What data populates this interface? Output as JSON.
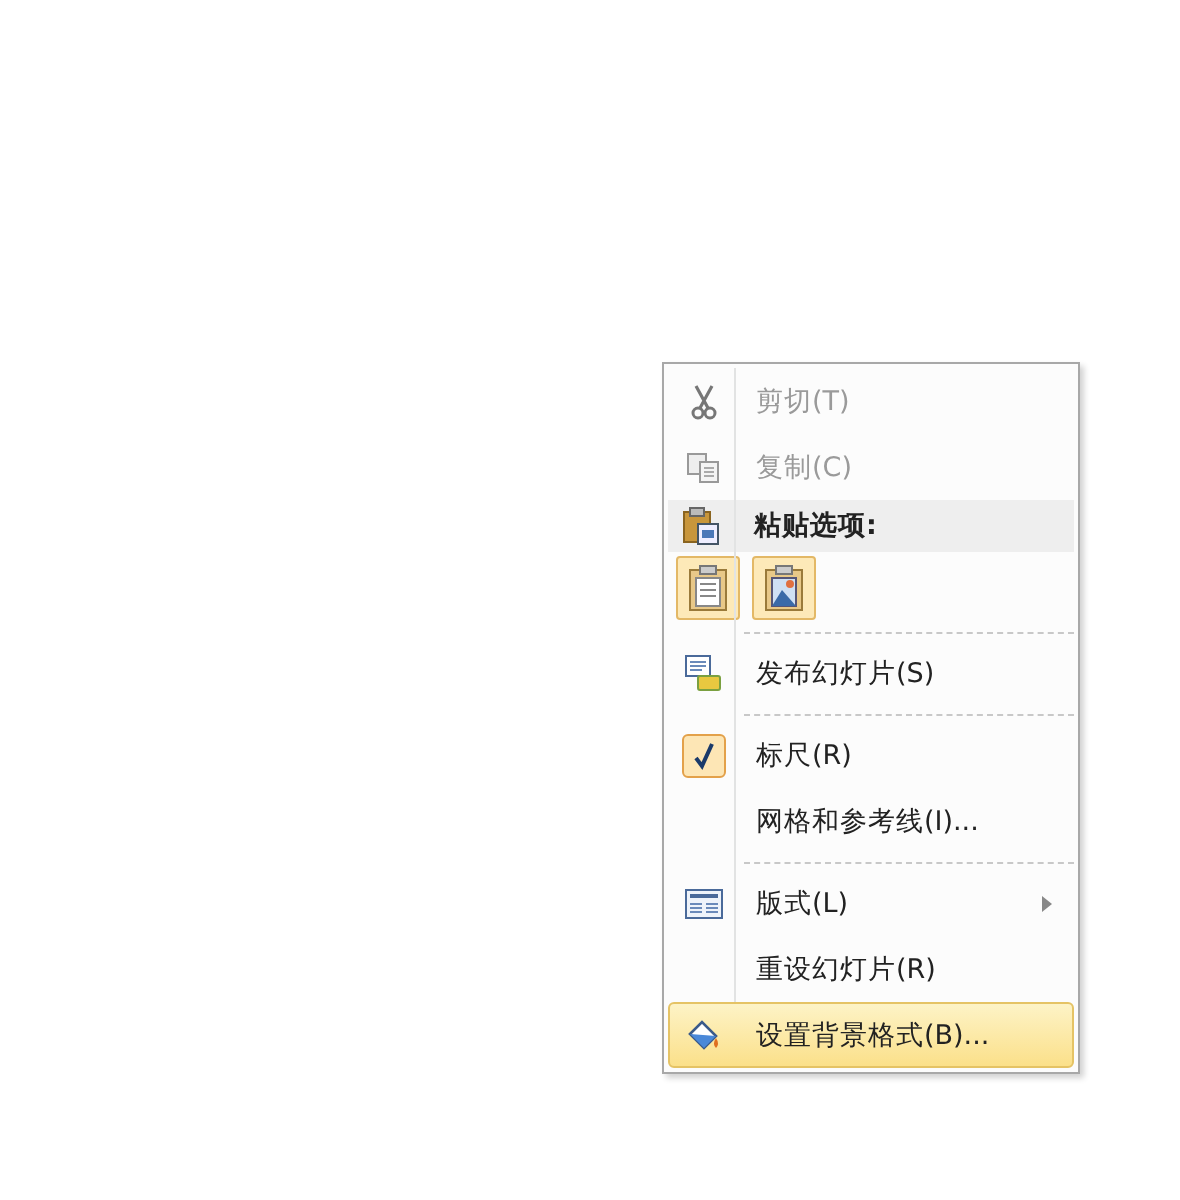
{
  "context_menu": {
    "entries": [
      {
        "kind": "item",
        "label": "剪切(T)",
        "disabled": true,
        "checked": false,
        "submenu": false,
        "selected": false
      },
      {
        "kind": "item",
        "label": "复制(C)",
        "disabled": true,
        "checked": false,
        "submenu": false,
        "selected": false
      },
      {
        "kind": "header",
        "label": "粘贴选项:"
      },
      {
        "kind": "paste_options"
      },
      {
        "kind": "separator"
      },
      {
        "kind": "item",
        "label": "发布幻灯片(S)",
        "disabled": false,
        "checked": false,
        "submenu": false,
        "selected": false
      },
      {
        "kind": "separator"
      },
      {
        "kind": "item",
        "label": "标尺(R)",
        "disabled": false,
        "checked": true,
        "submenu": false,
        "selected": false
      },
      {
        "kind": "item",
        "label": "网格和参考线(I)...",
        "disabled": false,
        "checked": false,
        "submenu": false,
        "selected": false
      },
      {
        "kind": "separator"
      },
      {
        "kind": "item",
        "label": "版式(L)",
        "disabled": false,
        "checked": false,
        "submenu": true,
        "selected": false
      },
      {
        "kind": "item",
        "label": "重设幻灯片(R)",
        "disabled": false,
        "checked": false,
        "submenu": false,
        "selected": false
      },
      {
        "kind": "item",
        "label": "设置背景格式(B)...",
        "disabled": false,
        "checked": false,
        "submenu": false,
        "selected": true
      }
    ]
  }
}
